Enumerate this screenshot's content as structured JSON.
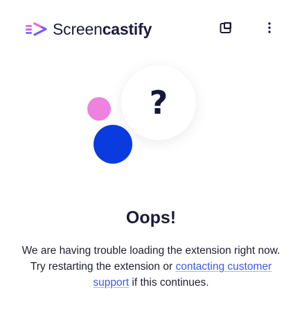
{
  "header": {
    "brand_light": "Screen",
    "brand_bold": "castify",
    "window_icon": "window-icon",
    "menu_icon": "kebab-menu-icon"
  },
  "illustration": {
    "symbol": "?",
    "colors": {
      "pink": "#ee82de",
      "blue": "#0a3bdf"
    }
  },
  "error": {
    "title": "Oops!",
    "message_before": "We are having trouble loading the extension right now. Try restarting the extension or ",
    "link_text": "contacting customer support",
    "message_after": " if this continues."
  },
  "colors": {
    "brand_pink": "#f06ad6",
    "brand_purple": "#6b5bff",
    "link": "#3b5bdb"
  }
}
